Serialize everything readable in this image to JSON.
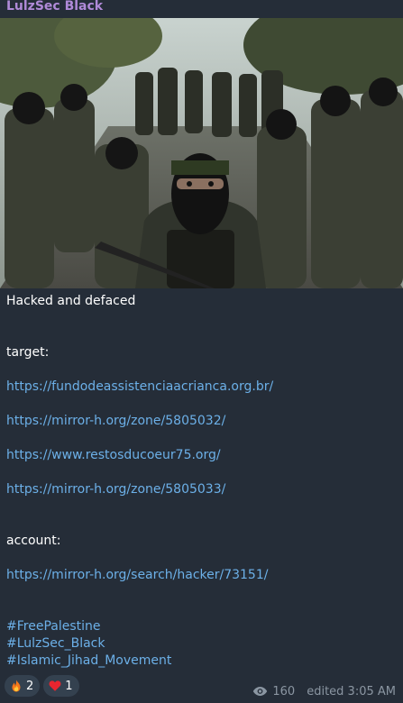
{
  "channel": {
    "sender_name": "LulzSec Black"
  },
  "message": {
    "photo_icon": "photo-image",
    "headline": "Hacked and defaced",
    "target_label": "target:",
    "target_links": [
      "https://fundodeassistenciaacrianca.org.br/",
      "https://mirror-h.org/zone/5805032/",
      "https://www.restosducoeur75.org/",
      "https://mirror-h.org/zone/5805033/"
    ],
    "account_label": "account:",
    "account_link": "https://mirror-h.org/search/hacker/73151/",
    "hashtags": [
      "#FreePalestine",
      "#LulzSec_Black",
      "#Islamic_Jihad_Movement"
    ]
  },
  "reactions": [
    {
      "icon": "fire-emoji",
      "count": "2"
    },
    {
      "icon": "heart-emoji",
      "count": "1"
    }
  ],
  "footer": {
    "views_icon": "eye-icon",
    "views": "160",
    "edited_time": "edited 3:05 AM"
  },
  "colors": {
    "bubble_bg": "#252d38",
    "sender": "#b08ad8",
    "link": "#6cb0e8",
    "meta": "#8b96a2",
    "reaction_bg": "#34414f"
  }
}
